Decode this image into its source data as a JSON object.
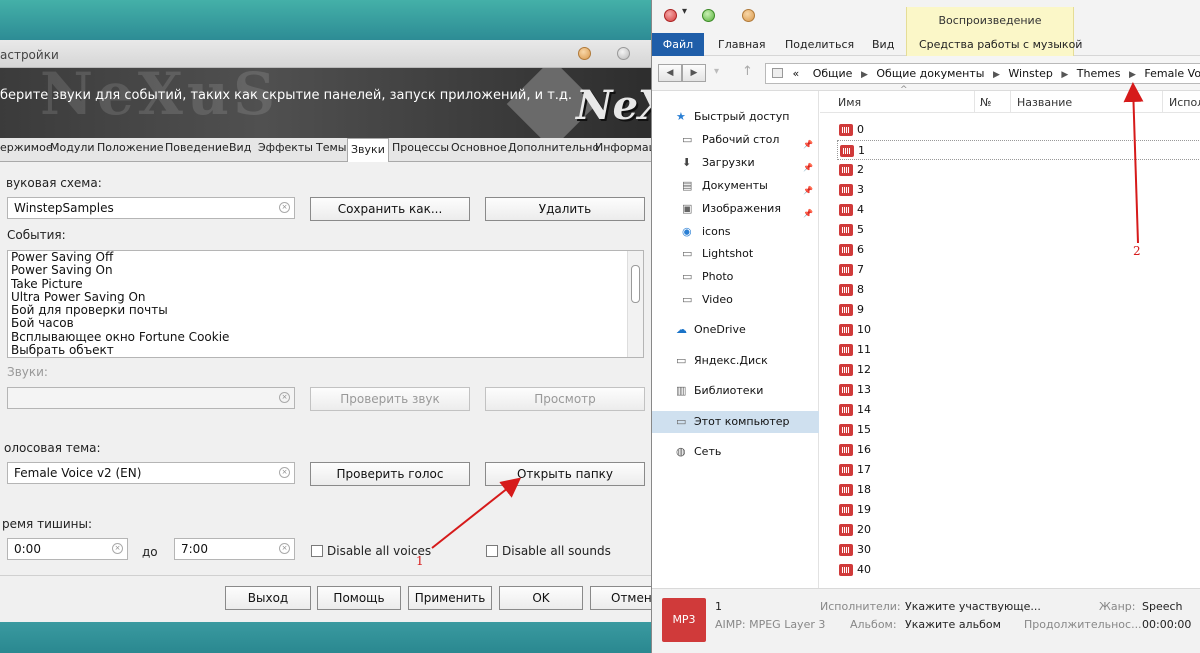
{
  "nexus": {
    "title": "астройки",
    "banner_text": "берите звуки для событий, таких как скрытие панелей, запуск приложений, и т.д.",
    "banner_word": "NeXuS",
    "logo": "NeXu",
    "tabs": [
      "ержимое",
      "Модули",
      "Положение",
      "Поведение",
      "Вид",
      "Эффекты",
      "Темы",
      "Звуки",
      "Процессы",
      "Основное",
      "Дополнительно",
      "Информаци"
    ],
    "active_tab": "Звуки",
    "scheme_label": "вуковая схема:",
    "scheme_value": "WinstepSamples",
    "save_as": "Сохранить как...",
    "delete": "Удалить",
    "events_label": "События:",
    "events": [
      "Power Saving Off",
      "Power Saving On",
      "Take Picture",
      "Ultra Power Saving On",
      "Бой для проверки почты",
      "Бой часов",
      "Всплывающее окно Fortune Cookie",
      "Выбрать объект"
    ],
    "sounds_label": "Звуки:",
    "sounds_value": "",
    "check_sound": "Проверить звук",
    "preview": "Просмотр",
    "voice_label": "олосовая тема:",
    "voice_value": "Female Voice v2 (EN)",
    "check_voice": "Проверить голос",
    "open_folder": "Открыть папку",
    "silence_label": "ремя тишины:",
    "from_time": "0:00",
    "to_word": "до",
    "to_time": "7:00",
    "disable_voices": "Disable all voices",
    "disable_sounds": "Disable all sounds",
    "btn_exit": "Выход",
    "btn_help": "Помощь",
    "btn_apply": "Применить",
    "btn_ok": "OK",
    "btn_cancel": "Отмена"
  },
  "aimp": {
    "ribbon_context": "Воспроизведение",
    "menus": [
      "Файл",
      "Главная",
      "Поделиться",
      "Вид",
      "Средства работы с музыкой"
    ],
    "path": [
      "Общие",
      "Общие документы",
      "Winstep",
      "Themes",
      "Female Voice"
    ],
    "path_prefix": "«",
    "nav": [
      {
        "label": "Быстрый доступ",
        "icon": "star-icon",
        "pin": false,
        "indent": 0
      },
      {
        "label": "Рабочий стол",
        "icon": "desktop-icon",
        "pin": true,
        "indent": 1
      },
      {
        "label": "Загрузки",
        "icon": "download-icon",
        "pin": true,
        "indent": 1
      },
      {
        "label": "Документы",
        "icon": "documents-icon",
        "pin": true,
        "indent": 1
      },
      {
        "label": "Изображения",
        "icon": "pictures-icon",
        "pin": true,
        "indent": 1
      },
      {
        "label": "icons",
        "icon": "icons-folder-icon",
        "pin": false,
        "indent": 1
      },
      {
        "label": "Lightshot",
        "icon": "folder-icon",
        "pin": false,
        "indent": 1
      },
      {
        "label": "Photo",
        "icon": "folder-icon",
        "pin": false,
        "indent": 1
      },
      {
        "label": "Video",
        "icon": "folder-icon",
        "pin": false,
        "indent": 1
      },
      {
        "label": "OneDrive",
        "icon": "onedrive-icon",
        "pin": false,
        "indent": 0
      },
      {
        "label": "Яндекс.Диск",
        "icon": "yandex-disk-icon",
        "pin": false,
        "indent": 0
      },
      {
        "label": "Библиотеки",
        "icon": "libraries-icon",
        "pin": false,
        "indent": 0
      },
      {
        "label": "Этот компьютер",
        "icon": "computer-icon",
        "pin": false,
        "indent": 0,
        "selected": true
      },
      {
        "label": "Сеть",
        "icon": "network-icon",
        "pin": false,
        "indent": 0
      }
    ],
    "columns": [
      "Имя",
      "№",
      "Название",
      "Испол"
    ],
    "files": [
      "0",
      "1",
      "2",
      "3",
      "4",
      "5",
      "6",
      "7",
      "8",
      "9",
      "10",
      "11",
      "12",
      "13",
      "14",
      "15",
      "16",
      "17",
      "18",
      "19",
      "20",
      "30",
      "40"
    ],
    "focused_file": "1",
    "status": {
      "badge": "MP3",
      "title": "1",
      "format": "AIMP: MPEG Layer 3",
      "artists_key": "Исполнители:",
      "artists_val": "Укажите участвующе...",
      "album_key": "Альбом:",
      "album_val": "Укажите альбом",
      "genre_key": "Жанр:",
      "genre_val": "Speech",
      "duration_key": "Продолжительнос...",
      "duration_val": "00:00:00"
    }
  },
  "annotations": {
    "one": "1",
    "two": "2"
  },
  "colors": {
    "accent_red": "#d61a1a",
    "file_menu": "#1f5ea9",
    "audio_icon": "#d03a3a"
  }
}
